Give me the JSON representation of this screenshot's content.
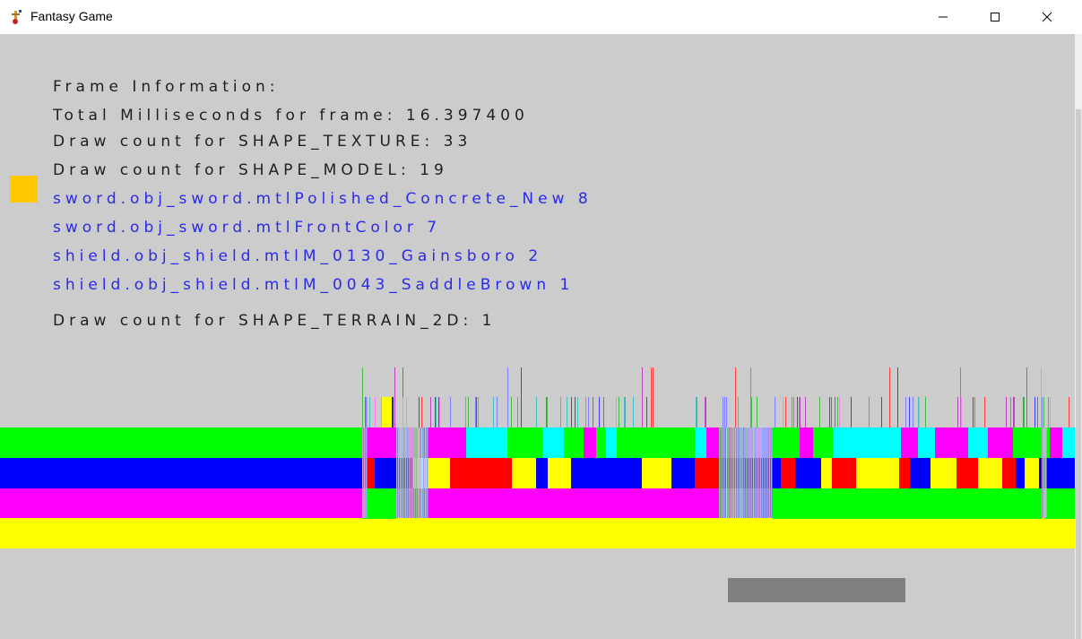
{
  "window": {
    "title": "Fantasy Game",
    "icon": "game-app-icon",
    "buttons": [
      "minimize",
      "maximize",
      "close"
    ]
  },
  "frame_info": {
    "header": "Frame Information:",
    "total_ms": "Total Milliseconds for frame: 16.397400",
    "texture_count": "Draw count for SHAPE_TEXTURE: 33",
    "model_count": "Draw count for SHAPE_MODEL: 19",
    "materials": [
      "sword.obj_sword.mtlPolished_Concrete_New 8",
      "sword.obj_sword.mtlFrontColor 7",
      "shield.obj_shield.mtlM_0130_Gainsboro 2",
      "shield.obj_shield.mtlM_0043_SaddleBrown 1"
    ],
    "terrain_count": "Draw count for SHAPE_TERRAIN_2D: 1"
  },
  "colors": {
    "background": "#cccccc",
    "text": "#1f1f1f",
    "material_text": "#2a2ae8",
    "marker": "#ffc800",
    "band_green": "#00ff00",
    "band_blue": "#0000ff",
    "band_magenta": "#ff00ff",
    "band_yellow": "#ffff00",
    "cyan": "#00ffff",
    "red": "#ff0000",
    "gray_bar": "#808080"
  }
}
